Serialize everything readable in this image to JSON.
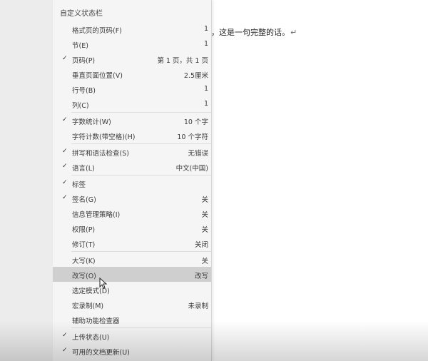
{
  "document": {
    "sentence": "，这是一句完整的话。",
    "paragraph_mark": "↵"
  },
  "menu": {
    "title": "自定义状态栏",
    "items": [
      {
        "label": "格式页的页码(F)",
        "value": "1",
        "checked": false
      },
      {
        "label": "节(E)",
        "value": "1",
        "checked": false
      },
      {
        "label": "页码(P)",
        "value": "第 1 页，共 1 页",
        "checked": true
      },
      {
        "label": "垂直页面位置(V)",
        "value": "2.5厘米",
        "checked": false
      },
      {
        "label": "行号(B)",
        "value": "1",
        "checked": false
      },
      {
        "label": "列(C)",
        "value": "1",
        "checked": false
      },
      {
        "label": "字数统计(W)",
        "value": "10 个字",
        "checked": true
      },
      {
        "label": "字符计数(带空格)(H)",
        "value": "10 个字符",
        "checked": false
      },
      {
        "label": "拼写和语法检查(S)",
        "value": "无错误",
        "checked": true
      },
      {
        "label": "语言(L)",
        "value": "中文(中国)",
        "checked": true
      },
      {
        "label": "标签",
        "value": "",
        "checked": true
      },
      {
        "label": "签名(G)",
        "value": "关",
        "checked": true
      },
      {
        "label": "信息管理策略(I)",
        "value": "关",
        "checked": false
      },
      {
        "label": "权限(P)",
        "value": "关",
        "checked": false
      },
      {
        "label": "修订(T)",
        "value": "关闭",
        "checked": false
      },
      {
        "label": "大写(K)",
        "value": "关",
        "checked": false
      },
      {
        "label": "改写(O)",
        "value": "改写",
        "checked": false,
        "highlighted": true
      },
      {
        "label": "选定模式(D)",
        "value": "",
        "checked": false
      },
      {
        "label": "宏录制(M)",
        "value": "未录制",
        "checked": false
      },
      {
        "label": "辅助功能检查器",
        "value": "",
        "checked": false
      },
      {
        "label": "上传状态(U)",
        "value": "",
        "checked": true
      },
      {
        "label": "可用的文档更新(U)",
        "value": "",
        "checked": true
      }
    ],
    "check_glyph": "✓"
  }
}
